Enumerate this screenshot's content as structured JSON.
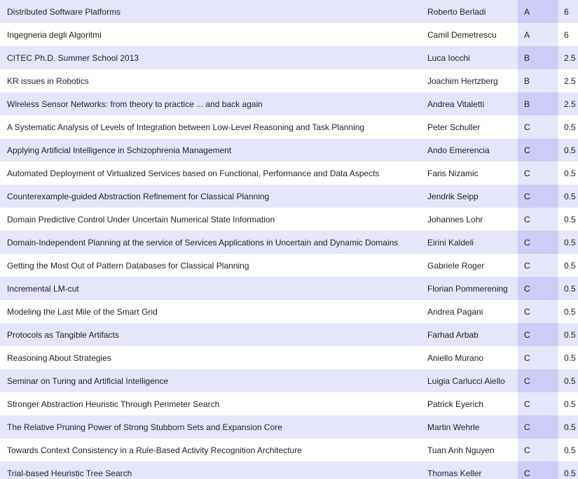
{
  "courses": {
    "rows": [
      {
        "title": "Distributed Software Platforms",
        "speaker": "Roberto Berladi",
        "type": "A",
        "credits": "6"
      },
      {
        "title": "Ingegneria degli Algoritmi",
        "speaker": "Camil Demetrescu",
        "type": "A",
        "credits": "6"
      },
      {
        "title": "CITEC Ph.D. Summer School 2013",
        "speaker": "Luca Iocchi",
        "type": "B",
        "credits": "2.5"
      },
      {
        "title": "KR issues in Robotics",
        "speaker": "Joachim Hertzberg",
        "type": "B",
        "credits": "2.5"
      },
      {
        "title": "Wireless Sensor Networks: from theory to practice ... and back again",
        "speaker": "Andrea Vitaletti",
        "type": "B",
        "credits": "2.5"
      },
      {
        "title": "A Systematic Analysis of Levels of Integration between Low-Level Reasoning and Task Planning",
        "speaker": "Peter Schuller",
        "type": "C",
        "credits": "0.5"
      },
      {
        "title": "Applying Artificial Intelligence in Schizophrenia Management",
        "speaker": "Ando Emerencia",
        "type": "C",
        "credits": "0.5"
      },
      {
        "title": "Automated Deployment of Virtualized Services based on Functional, Performance and Data Aspects",
        "speaker": "Faris Nizamic",
        "type": "C",
        "credits": "0.5"
      },
      {
        "title": "Counterexample-guided Abstraction Refinement for Classical Planning",
        "speaker": "Jendrik Seipp",
        "type": "C",
        "credits": "0.5"
      },
      {
        "title": "Domain Predictive Control Under Uncertain Numerical State Information",
        "speaker": "Johannes Lohr",
        "type": "C",
        "credits": "0.5"
      },
      {
        "title": "Domain-Independent Planning at the service of Services Applications in Uncertain and Dynamic Domains",
        "speaker": "Eirini Kaldeli",
        "type": "C",
        "credits": "0.5"
      },
      {
        "title": "Getting the Most Out of Pattern Databases for Classical Planning",
        "speaker": "Gabriele Roger",
        "type": "C",
        "credits": "0.5"
      },
      {
        "title": "Incremental LM-cut",
        "speaker": "Florian Pommerening",
        "type": "C",
        "credits": "0.5"
      },
      {
        "title": "Modeling the Last Mile of the Smart Grid",
        "speaker": "Andrea Pagani",
        "type": "C",
        "credits": "0.5"
      },
      {
        "title": "Protocols as Tangible Artifacts",
        "speaker": "Farhad Arbab",
        "type": "C",
        "credits": "0.5"
      },
      {
        "title": "Reasoning About Strategies",
        "speaker": "Aniello Murano",
        "type": "C",
        "credits": "0.5"
      },
      {
        "title": "Seminar on Turing and Artificial Intelligence",
        "speaker": "Luigia Carlucci Aiello",
        "type": "C",
        "credits": "0.5"
      },
      {
        "title": "Stronger Abstraction Heuristic Through Perimeter Search",
        "speaker": "Patrick Eyerich",
        "type": "C",
        "credits": "0.5"
      },
      {
        "title": "The Relative Pruning Power of Strong Stubborn Sets and Expansion Core",
        "speaker": "Martin Wehrle",
        "type": "C",
        "credits": "0.5"
      },
      {
        "title": "Towards Context Consistency in a Rule-Based Activity Recognition Architecture",
        "speaker": "Tuan Anh Nguyen",
        "type": "C",
        "credits": "0.5"
      },
      {
        "title": "Trial-based Heuristic Tree Search",
        "speaker": "Thomas Keller",
        "type": "C",
        "credits": "0.5"
      }
    ]
  }
}
